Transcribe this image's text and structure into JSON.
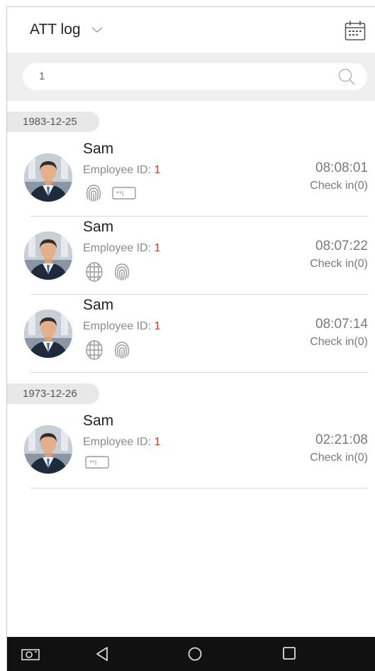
{
  "header": {
    "title": "ATT log",
    "dropdown_icon": "chevron-down-icon",
    "calendar_icon": "calendar-icon"
  },
  "search": {
    "value": "1",
    "icon": "search-icon"
  },
  "groups": [
    {
      "date": "1983-12-25",
      "records": [
        {
          "name": "Sam",
          "id_label": "Employee ID:",
          "id_value": "1",
          "time": "08:08:01",
          "status": "Check in(0)",
          "methods": [
            "fingerprint",
            "password"
          ]
        },
        {
          "name": "Sam",
          "id_label": "Employee ID:",
          "id_value": "1",
          "time": "08:07:22",
          "status": "Check in(0)",
          "methods": [
            "face",
            "fingerprint"
          ]
        },
        {
          "name": "Sam",
          "id_label": "Employee ID:",
          "id_value": "1",
          "time": "08:07:14",
          "status": "Check in(0)",
          "methods": [
            "face",
            "fingerprint"
          ]
        }
      ]
    },
    {
      "date": "1973-12-26",
      "records": [
        {
          "name": "Sam",
          "id_label": "Employee ID:",
          "id_value": "1",
          "time": "02:21:08",
          "status": "Check in(0)",
          "methods": [
            "password"
          ]
        }
      ]
    }
  ],
  "navbar": {
    "icons": [
      "screenshot-icon",
      "back-icon",
      "home-icon",
      "recents-icon"
    ]
  },
  "colors": {
    "accent_red": "#e5312a",
    "nav_bg": "#111111",
    "chip_bg": "#e8e8e8"
  }
}
